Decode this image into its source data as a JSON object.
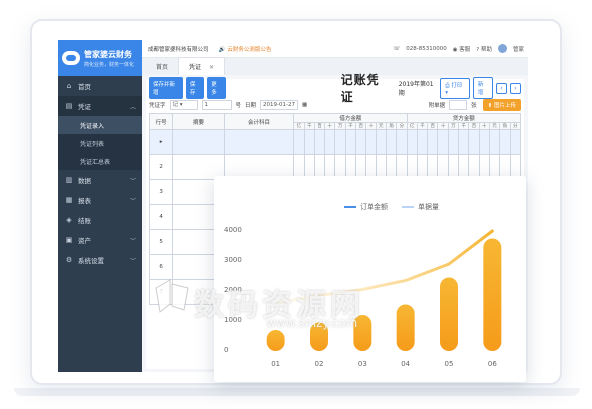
{
  "brand": {
    "name": "管家婆云财务",
    "slogan": "简化业务，财务一体化"
  },
  "topbar": {
    "company": "成都管家婆科技有限公司",
    "notice": "云财务公测版公告",
    "phone": "028-85310000",
    "service": "客服",
    "help": "帮助",
    "user": "管家"
  },
  "sidebar": {
    "items": [
      {
        "label": "首页",
        "icon": "home-icon"
      },
      {
        "label": "凭证",
        "icon": "voucher-icon",
        "expanded": true
      },
      {
        "label": "数据",
        "icon": "data-icon"
      },
      {
        "label": "报表",
        "icon": "report-icon"
      },
      {
        "label": "结账",
        "icon": "close-account-icon"
      },
      {
        "label": "资产",
        "icon": "asset-icon"
      },
      {
        "label": "系统设置",
        "icon": "settings-icon"
      }
    ],
    "sub_items": [
      "凭证录入",
      "凭证列表",
      "凭证汇总表"
    ]
  },
  "tabs": [
    {
      "label": "首页"
    },
    {
      "label": "凭证"
    }
  ],
  "toolbar": {
    "save_new": "保存并新增",
    "save": "保存",
    "more": "更多",
    "title": "记账凭证",
    "period": "2019年第01期",
    "print": "打印",
    "new": "新增"
  },
  "form": {
    "voucher_word_label": "凭证字",
    "voucher_word_value": "记",
    "number_value": "1",
    "number_unit": "号",
    "date_label": "日期",
    "date_value": "2019-01-27",
    "attachment_label": "附单据",
    "attachment_unit": "张",
    "upload_label": "图片上传"
  },
  "table": {
    "headers": [
      "行号",
      "摘要",
      "会计科目",
      "借方金额",
      "贷方金额"
    ],
    "digits": [
      "亿",
      "千",
      "百",
      "十",
      "万",
      "千",
      "百",
      "十",
      "元",
      "角",
      "分"
    ],
    "rows": [
      "▸",
      "2",
      "3",
      "4",
      "5",
      "6",
      "7"
    ]
  },
  "chart_data": {
    "type": "bar",
    "categories": [
      "01",
      "02",
      "03",
      "04",
      "05",
      "06"
    ],
    "series": [
      {
        "name": "订单金额",
        "kind": "line",
        "color": "#4a8fe7"
      },
      {
        "name": "单据量",
        "kind": "bar",
        "color": "#f5a623"
      }
    ],
    "values": [
      700,
      950,
      1200,
      1550,
      2450,
      3750
    ],
    "line_values": [
      1600,
      1850,
      2050,
      2350,
      2900,
      4000
    ],
    "yticks": [
      "4000",
      "3000",
      "2000",
      "1000",
      "0"
    ],
    "ylim": [
      0,
      4000
    ],
    "legend_position": "top-center"
  },
  "watermark": {
    "text": "数码资源网",
    "sub": "www.smzy.com"
  }
}
